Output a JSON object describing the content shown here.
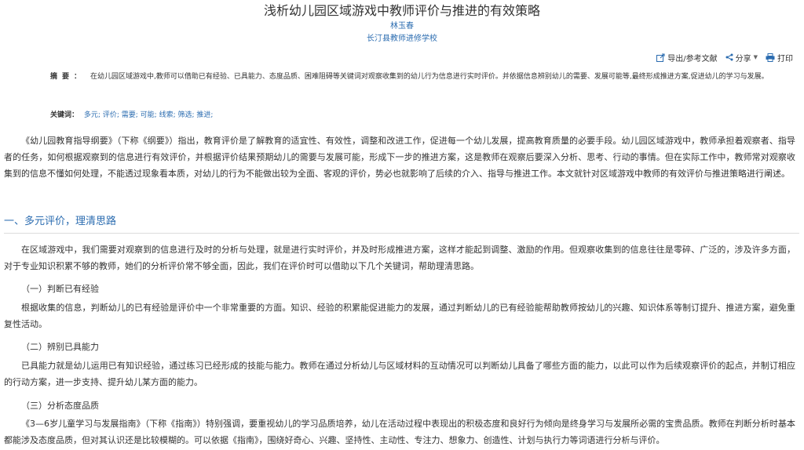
{
  "header": {
    "title": "浅析幼儿园区域游戏中教师评价与推进的有效策略",
    "author": "林玉春",
    "org": "长汀县教师进修学校"
  },
  "toolbar": {
    "export_label": "导出/参考文献",
    "share_label": "分享",
    "print_label": "打印"
  },
  "abstract": {
    "label": "摘要：",
    "text": "在幼儿园区域游戏中,教师可以借助已有经验、已具能力、态度品质、困难阻碍等关键词对观察收集到的幼儿行为信息进行实时评价。并依据信息辨别幼儿的需要、发展可能等,最终形成推进方案,促进幼儿的学习与发展。"
  },
  "keywords": {
    "label": "关键词：",
    "items": [
      "多元;",
      "评价;",
      "需要;",
      "可能;",
      "线索;",
      "筛选;",
      "推进;"
    ]
  },
  "body": {
    "p1": "《幼儿园教育指导纲要》（下称《纲要》）指出，教育评价是了解教育的适宜性、有效性，调整和改进工作，促进每一个幼儿发展，提高教育质量的必要手段。幼儿园区域游戏中，教师承担着观察者、指导者的任务，如何根据观察到的信息进行有效评价，并根据评价结果预期幼儿的需要与发展可能，形成下一步的推进方案，这是教师在观察后要深入分析、思考、行动的事情。但在实际工作中，教师常对观察收集到的信息不懂如何处理，不能透过现象看本质，对幼儿的行为不能做出较为全面、客观的评价，势必也就影响了后续的介入、指导与推进工作。本文就针对区域游戏中教师的有效评价与推进策略进行阐述。",
    "section1": "一、多元评价，理清思路",
    "p2": "在区域游戏中，我们需要对观察到的信息进行及时的分析与处理，就是进行实时评价，并及时形成推进方案，这样才能起到调整、激励的作用。但观察收集到的信息往往是零碎、广泛的，涉及许多方面，对于专业知识积累不够的教师，她们的分析评价常不够全面，因此，我们在评价时可以借助以下几个关键词，帮助理清思路。",
    "sub1": "（一）判断已有经验",
    "p3": "根据收集的信息，判断幼儿的已有经验是评价中一个非常重要的方面。知识、经验的积累能促进能力的发展，通过判断幼儿的已有经验能帮助教师按幼儿的兴趣、知识体系等制订提升、推进方案，避免重复性活动。",
    "sub2": "（二）辨别已具能力",
    "p4": "已具能力就是幼儿运用已有知识经验，通过练习已经形成的技能与能力。教师在通过分析幼儿与区域材料的互动情况可以判断幼儿具备了哪些方面的能力，以此可以作为后续观察评价的起点，并制订相应的行动方案，进一步支持、提升幼儿某方面的能力。",
    "sub3": "（三）分析态度品质",
    "p5": "《3—6岁儿童学习与发展指南》（下称《指南》）特别强调，要重视幼儿的学习品质培养，幼儿在活动过程中表现出的积极态度和良好行为倾向是终身学习与发展所必需的宝贵品质。教师在判断分析时基本都能涉及态度品质，但对其认识还是比较模糊的。可以依据《指南》，围绕好奇心、兴趣、坚持性、主动性、专注力、想象力、创造性、计划与执行力等词语进行分析与评价。"
  }
}
